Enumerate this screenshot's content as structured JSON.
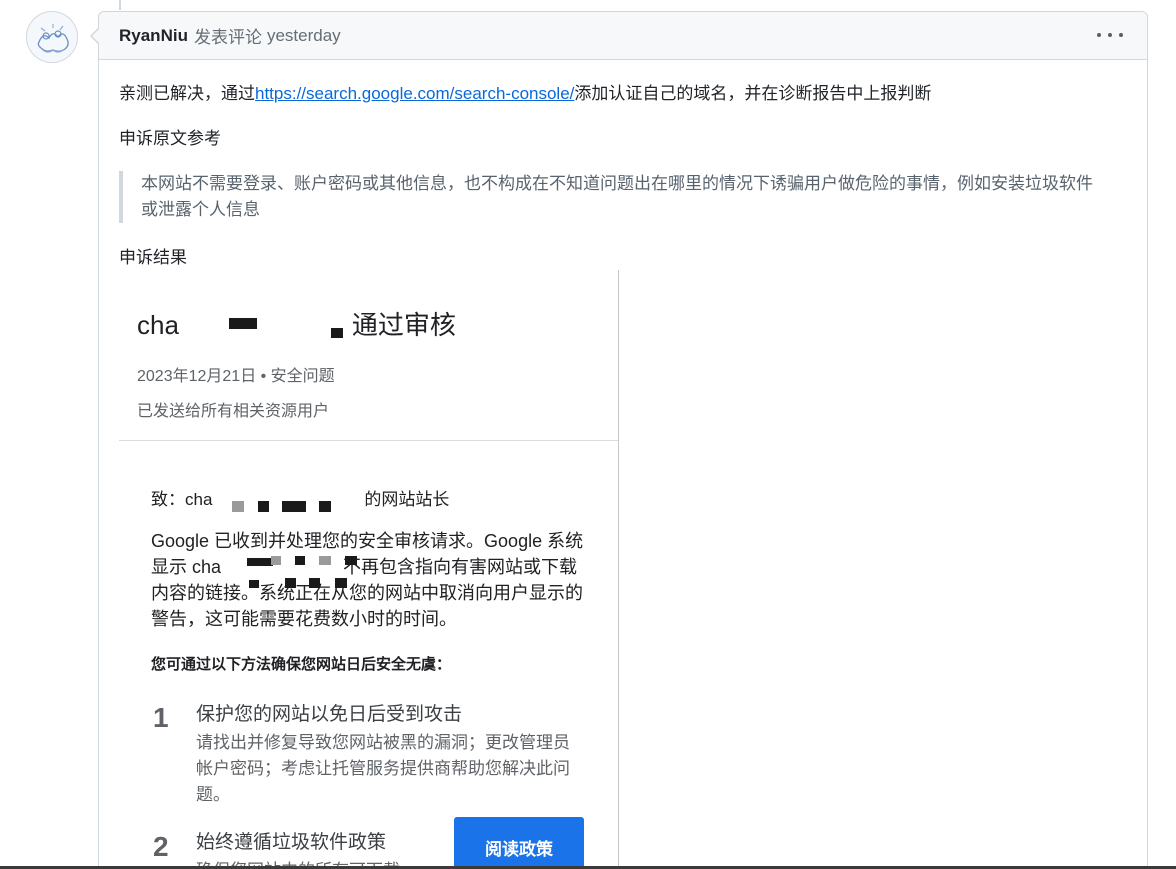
{
  "comment": {
    "author": "RyanNiu",
    "verb": "发表评论",
    "time": "yesterday",
    "p1_before": "亲测已解决，通过",
    "p1_link": "https://search.google.com/search-console/",
    "p1_after": "添加认证自己的域名，并在诊断报告中上报判断",
    "p2": "申诉原文参考",
    "quote": "本网站不需要登录、账户密码或其他信息，也不构成在不知道问题出在哪里的情况下诱骗用户做危险的事情，例如安装垃圾软件或泄露个人信息",
    "p3": "申诉结果"
  },
  "email": {
    "title_prefix": "cha",
    "title_suffix": "通过审核",
    "date": "2023年12月21日 • 安全问题",
    "sent_to": "已发送给所有相关资源用户",
    "to_prefix": "致：cha",
    "to_suffix": "的网站站长",
    "para_1": "Google 已收到并处理您的安全审核请求。Google 系统显示 cha",
    "para_2": "不再包含指向有害网站或下载内容的链接。系统正在从您的网站中取消向用户显示的警告，这可能需要花费数小时的时间。",
    "bold_line": "您可通过以下方法确保您网站日后安全无虞：",
    "steps": [
      {
        "num": "1",
        "title": "保护您的网站以免日后受到攻击",
        "desc": "请找出并修复导致您网站被黑的漏洞；更改管理员帐户密码；考虑让托管服务提供商帮助您解决此问题。"
      },
      {
        "num": "2",
        "title": "始终遵循垃圾软件政策",
        "desc": "确保您网站中的所有可下载"
      }
    ],
    "policy_button": "阅读政策"
  },
  "colors": {
    "link": "#0969da",
    "button": "#1a73e8",
    "header_bg": "#f6f8fa",
    "border": "#d0d7de"
  }
}
